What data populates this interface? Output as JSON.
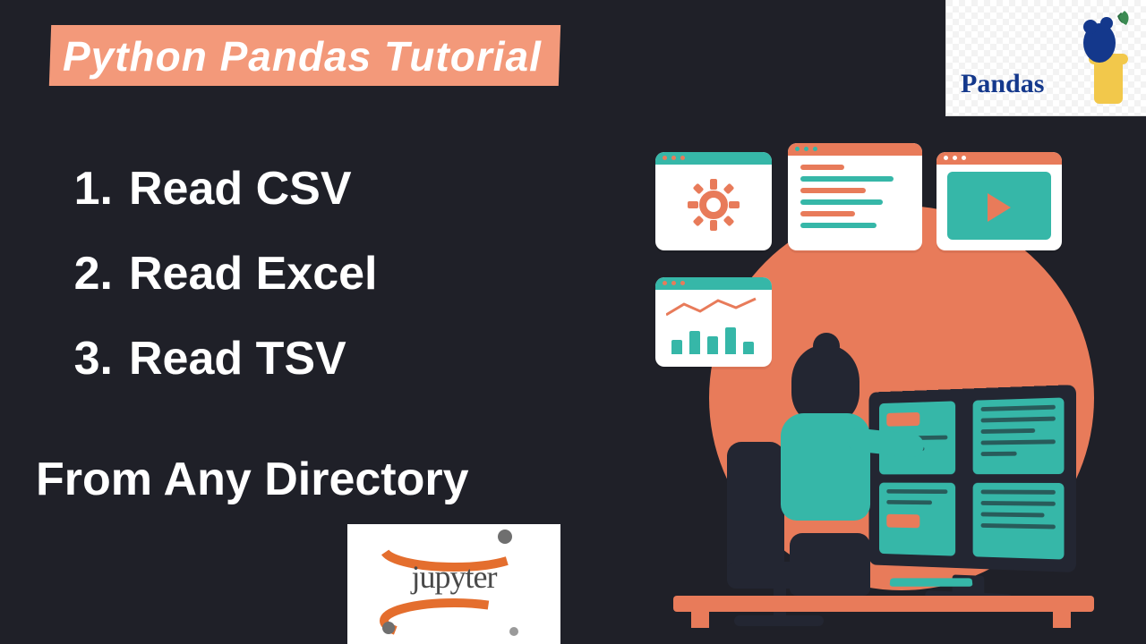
{
  "title": "Python Pandas Tutorial",
  "list": {
    "items": [
      {
        "num": "1.",
        "text": "Read CSV"
      },
      {
        "num": "2.",
        "text": "Read Excel"
      },
      {
        "num": "3.",
        "text": "Read TSV"
      }
    ]
  },
  "footer": "From Any Directory",
  "logos": {
    "pandas": "Pandas",
    "jupyter": "jupyter"
  }
}
